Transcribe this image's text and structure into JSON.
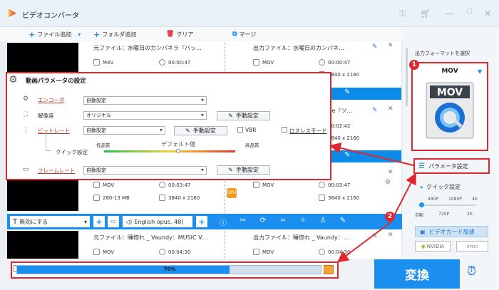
{
  "titlebar": {
    "title": "ビデオコンバータ"
  },
  "toolbar": {
    "add_file": "ファイル追加",
    "add_folder": "フォルダ追加",
    "clear": "クリア",
    "merge": "マージ"
  },
  "files": [
    {
      "source": "元ファイル：水曜日のカンパネラ『バッ…",
      "src_format": "M4V",
      "src_duration": "00:00:47",
      "output": "出力ファイル：水曜日のカンパネ…",
      "out_format": "MOV",
      "out_duration": "00:00:47",
      "out_resolution": "3840 x 2160"
    },
    {
      "source": "",
      "src_format": "",
      "src_duration": "",
      "output": "nce『ツ…",
      "out_format": "MOV",
      "out_duration": "00:02:42",
      "out_resolution": "3840 x 2160"
    },
    {
      "source": "",
      "src_format": "MOV",
      "src_duration": "00:03:47",
      "src_size": "280-13 MB",
      "src_resolution": "3840 x 2160",
      "output": "",
      "out_format": "MOV",
      "out_duration": "00:03:47",
      "out_resolution": "3840 x 2160"
    },
    {
      "source": "元ファイル：睡惚れ _ Vaundy：MUSIC V…",
      "src_format": "MOV",
      "src_duration": "00:04:30",
      "output": "出力ファイル：睡惚れ _ Vaundy：…",
      "out_format": "MOV",
      "out_duration": "00:04:30"
    }
  ],
  "editbar": {
    "subtitle": "無効にする",
    "audio": "English opus, 48("
  },
  "progress": {
    "value": 0.7,
    "label": "70%"
  },
  "convert": {
    "label": "変換"
  },
  "right_panel": {
    "output_format_label": "出力フォーマットを選択",
    "format": "MOV",
    "param_button": "パラメータ設定",
    "quick_title": "クイック設定",
    "quick_top": [
      "480P",
      "1080P",
      "4K"
    ],
    "quick_bottom": [
      "自動",
      "720P",
      "2K"
    ],
    "gpu_button": "ビデオカード加速",
    "nvidia": "NVIDIA",
    "intel": "intel"
  },
  "dialog": {
    "title": "動画パラメータの設定",
    "encoder_label": "エンコーダ",
    "encoder_value": "自動設定",
    "resolution_label": "解像度",
    "resolution_value": "オリジナル",
    "bitrate_label": "ビットレート",
    "bitrate_value": "自動設定",
    "vbr_label": "VBR",
    "lossless_label": "ロスレスモード",
    "quick_label": "クイック設定",
    "low": "低品質",
    "default": "デフォルト値",
    "high": "高品質",
    "framerate_label": "フレームレート",
    "framerate_value": "自動設定",
    "manual": "手動設定"
  },
  "badges": [
    "1",
    "2"
  ],
  "colors": {
    "accent": "#1a8ff0",
    "highlight": "#e0262f"
  }
}
